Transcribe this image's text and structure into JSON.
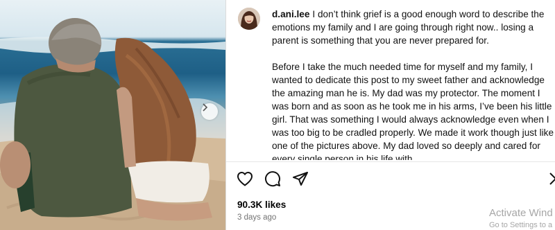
{
  "post": {
    "username": "d.ani.lee",
    "caption_first": "I don’t think grief is a good enough word to describe the emotions my family and I are going through right now.. losing a parent is something that you are never prepared for.",
    "caption_second": "Before I take the much needed time for myself and my family, I wanted to dedicate this post to my sweet father and acknowledge the amazing man he is. My dad was my protector. The moment I was born and as soon as he took me in his arms, I’ve been his little girl. That was something I would always acknowledge even when I was too big to be cradled properly. We made it work though just like one of the pictures above. My dad loved so deeply and cared for every single person in his life with",
    "likes": "90.3K likes",
    "date": "3 days ago"
  },
  "icons": {
    "like": "heart-icon",
    "comment": "comment-icon",
    "share": "send-icon",
    "next": "chevron-right-icon"
  },
  "watermark": {
    "title": "Activate Wind",
    "subtitle": "Go to Settings to a"
  }
}
